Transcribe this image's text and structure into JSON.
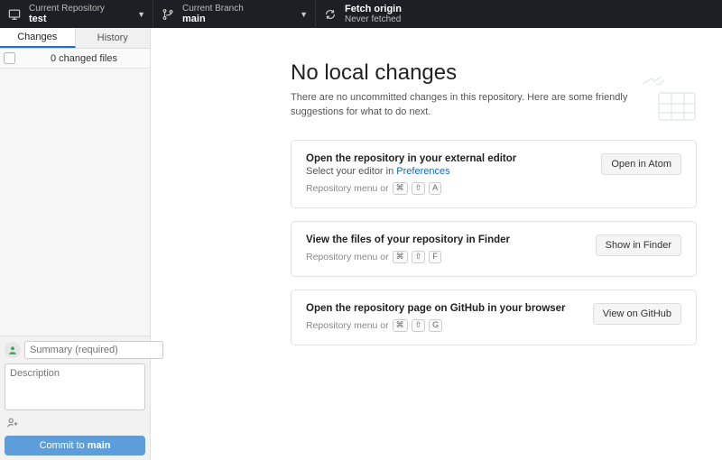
{
  "toolbar": {
    "repo": {
      "label": "Current Repository",
      "value": "test"
    },
    "branch": {
      "label": "Current Branch",
      "value": "main"
    },
    "fetch": {
      "label": "Fetch origin",
      "value": "Never fetched"
    }
  },
  "sidebar": {
    "tabs": {
      "changes": "Changes",
      "history": "History"
    },
    "changed_files": "0 changed files"
  },
  "commit": {
    "summary_placeholder": "Summary (required)",
    "description_placeholder": "Description",
    "button_prefix": "Commit to ",
    "button_branch": "main"
  },
  "main": {
    "title": "No local changes",
    "subtitle": "There are no uncommitted changes in this repository. Here are some friendly suggestions for what to do next."
  },
  "cards": {
    "editor": {
      "title": "Open the repository in your external editor",
      "sub_prefix": "Select your editor in ",
      "sub_link": "Preferences",
      "hint_text": "Repository menu or",
      "keys": [
        "⌘",
        "⇧",
        "A"
      ],
      "button": "Open in Atom"
    },
    "finder": {
      "title": "View the files of your repository in Finder",
      "hint_text": "Repository menu or",
      "keys": [
        "⌘",
        "⇧",
        "F"
      ],
      "button": "Show in Finder"
    },
    "github": {
      "title": "Open the repository page on GitHub in your browser",
      "hint_text": "Repository menu or",
      "keys": [
        "⌘",
        "⇧",
        "G"
      ],
      "button": "View on GitHub"
    }
  }
}
